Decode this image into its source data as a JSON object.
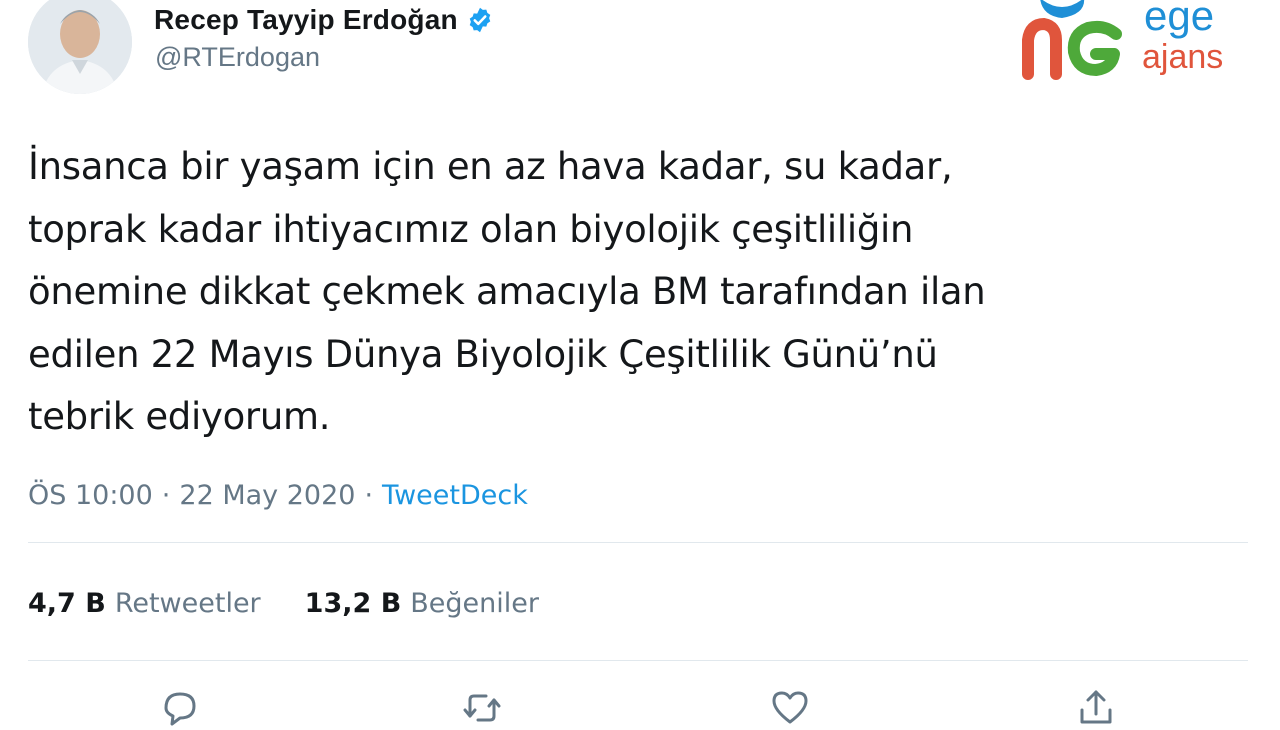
{
  "tweet": {
    "author": {
      "display_name": "Recep Tayyip Erdoğan",
      "handle": "@RTErdogan",
      "verified": true
    },
    "text_lines": [
      "İnsanca bir yaşam için en az hava kadar, su kadar,",
      "toprak kadar ihtiyacımız olan biyolojik çeşitliliğin",
      "önemine dikkat çekmek amacıyla BM tarafından ilan",
      "edilen 22 Mayıs Dünya Biyolojik Çeşitlilik Günü’nü",
      "tebrik ediyorum."
    ],
    "time": "ÖS 10:00",
    "date": "22 May 2020",
    "separator": "·",
    "source": "TweetDeck",
    "stats": {
      "retweets": {
        "count": "4,7 B",
        "label": "Retweetler"
      },
      "likes": {
        "count": "13,2 B",
        "label": "Beğeniler"
      }
    }
  },
  "watermark": {
    "line1": "ege",
    "line2": "ajans"
  },
  "icons": {
    "verified": "verified-badge-icon",
    "reply": "reply-icon",
    "retweet": "retweet-icon",
    "like": "heart-icon",
    "share": "share-icon"
  },
  "colors": {
    "text": "#14171a",
    "secondary": "#657786",
    "link": "#1b95e0",
    "verified": "#1da1f2",
    "divider": "#e1e8ed",
    "logo_blue": "#1f8fd6",
    "logo_red": "#e0553c",
    "logo_green": "#4ea93a"
  }
}
